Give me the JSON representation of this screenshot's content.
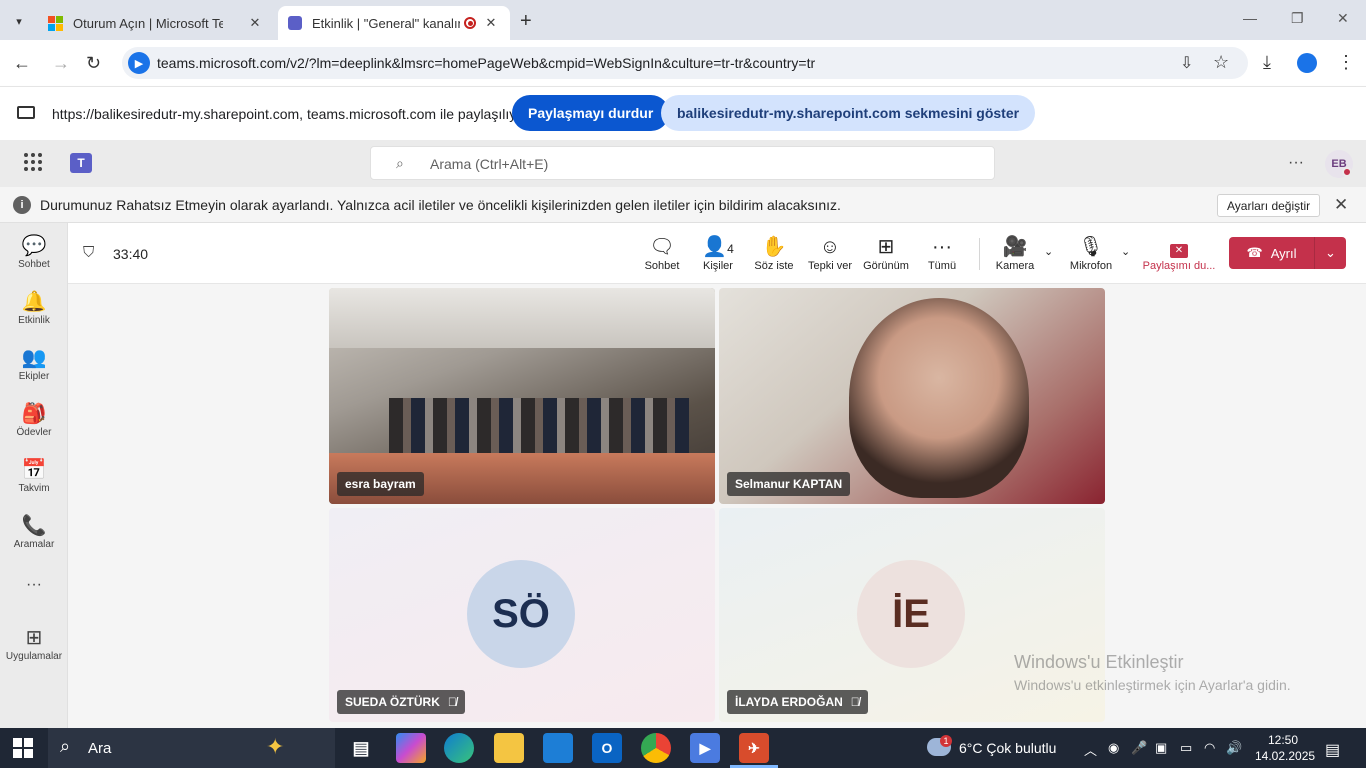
{
  "browser": {
    "tabs": [
      {
        "title": "Oturum Açın | Microsoft Teams",
        "active": false
      },
      {
        "title": "Etkinlik | \"General\" kanalında",
        "active": true
      }
    ],
    "new_tab": "+",
    "url": "teams.microsoft.com/v2/?lm=deeplink&lmsrc=homePageWeb&cmpid=WebSignIn&culture=tr-tr&country=tr"
  },
  "share_bar": {
    "text": "https://balikesiredutr-my.sharepoint.com, teams.microsoft.com ile paylaşılıyor",
    "stop_label": "Paylaşmayı durdur",
    "show_tab_label": "balikesiredutr-my.sharepoint.com sekmesini göster"
  },
  "teams": {
    "search_placeholder": "Arama (Ctrl+Alt+E)",
    "avatar_initials": "EB",
    "more": "···"
  },
  "banner": {
    "text": "Durumunuz Rahatsız Etmeyin olarak ayarlandı. Yalnızca acil iletiler ve öncelikli kişilerinizden gelen iletiler için bildirim alacaksınız.",
    "button": "Ayarları değiştir"
  },
  "rail": [
    {
      "label": "Sohbet",
      "icon": "chat-icon"
    },
    {
      "label": "Etkinlik",
      "icon": "bell-icon"
    },
    {
      "label": "Ekipler",
      "icon": "teams-icon"
    },
    {
      "label": "Ödevler",
      "icon": "backpack-icon"
    },
    {
      "label": "Takvim",
      "icon": "calendar-icon"
    },
    {
      "label": "Aramalar",
      "icon": "phone-icon"
    },
    {
      "label": "···",
      "icon": "more-icon"
    },
    {
      "label": "Uygulamalar",
      "icon": "add-icon"
    }
  ],
  "meeting": {
    "timer": "33:40",
    "toolbar": {
      "chat": "Sohbet",
      "people": "Kişiler",
      "people_count": "4",
      "raise_hand": "Söz iste",
      "react": "Tepki ver",
      "view": "Görünüm",
      "more": "Tümü",
      "camera": "Kamera",
      "mic": "Mikrofon",
      "stop_share": "Paylaşımı du...",
      "leave": "Ayrıl"
    },
    "participants": [
      {
        "name": "esra bayram",
        "video": true
      },
      {
        "name": "Selmanur KAPTAN",
        "video": true
      },
      {
        "name": "SUEDA ÖZTÜRK",
        "initials": "SÖ",
        "muted": true
      },
      {
        "name": "İLAYDA ERDOĞAN",
        "initials": "İE",
        "muted": true
      }
    ],
    "watermark": {
      "title": "Windows'u Etkinleştir",
      "subtitle": "Windows'u etkinleştirmek için Ayarlar'a gidin."
    }
  },
  "taskbar": {
    "search": "Ara",
    "weather": "6°C  Çok bulutlu",
    "weather_badge": "1",
    "time": "12:50",
    "date": "14.02.2025"
  }
}
